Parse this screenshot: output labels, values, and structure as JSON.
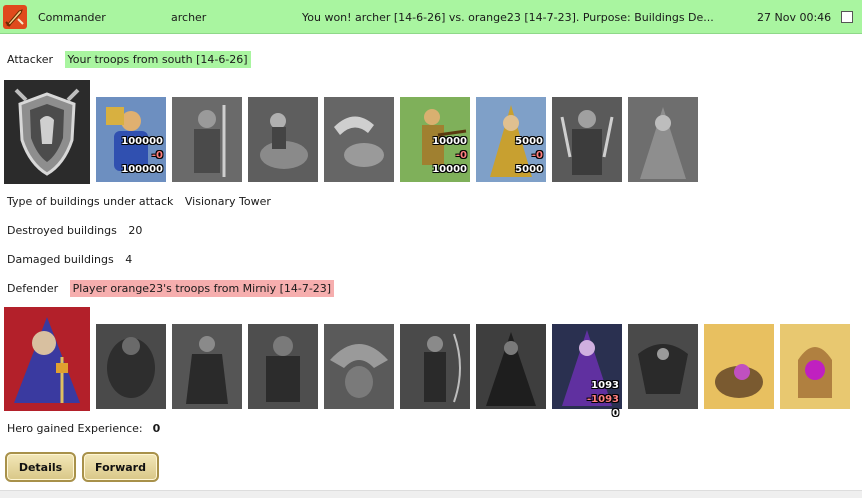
{
  "header": {
    "commander_label": "Commander",
    "name": "archer",
    "subject": "You won! archer [14-6-26] vs. orange23 [14-7-23]. Purpose: Buildings De...",
    "date": "27 Nov 00:46"
  },
  "attacker": {
    "label": "Attacker",
    "troops": "Your troops from south [14-6-26]",
    "units": [
      {
        "name": "coat-of-arms",
        "color": "gray"
      },
      {
        "name": "merchant",
        "color": "color",
        "numbers": [
          "100000",
          "-0",
          "100000"
        ]
      },
      {
        "name": "halberdier",
        "color": "gray"
      },
      {
        "name": "knight-on-horse",
        "color": "gray"
      },
      {
        "name": "pegasus",
        "color": "gray"
      },
      {
        "name": "crossbowman",
        "color": "color",
        "numbers": [
          "10000",
          "-0",
          "10000"
        ]
      },
      {
        "name": "mage",
        "color": "color",
        "numbers": [
          "5000",
          "-0",
          "5000"
        ]
      },
      {
        "name": "swordsman",
        "color": "gray"
      },
      {
        "name": "monk",
        "color": "gray"
      }
    ]
  },
  "building_type": {
    "label": "Type of buildings under attack",
    "value": "Visionary Tower"
  },
  "destroyed": {
    "label": "Destroyed buildings",
    "value": "20"
  },
  "damaged": {
    "label": "Damaged buildings",
    "value": "4"
  },
  "defender": {
    "label": "Defender",
    "troops": "Player orange23's troops from Mirniy [14-7-23]",
    "units": [
      {
        "name": "dark-hero",
        "color": "color"
      },
      {
        "name": "golem",
        "color": "gray"
      },
      {
        "name": "assassin",
        "color": "gray"
      },
      {
        "name": "dark-knight",
        "color": "gray"
      },
      {
        "name": "gargoyle",
        "color": "gray"
      },
      {
        "name": "archer-elf",
        "color": "gray"
      },
      {
        "name": "dark-priest",
        "color": "gray"
      },
      {
        "name": "necromancer",
        "color": "color",
        "numbers": [
          "1093",
          "-1093",
          "0"
        ]
      },
      {
        "name": "bone-dragon",
        "color": "gray"
      },
      {
        "name": "hatchling",
        "color": "color"
      },
      {
        "name": "egg-shrine",
        "color": "color"
      }
    ]
  },
  "experience": {
    "label": "Hero gained Experience:",
    "value": "0"
  },
  "buttons": {
    "details": "Details",
    "forward": "Forward"
  },
  "colors": {
    "header_bg": "#a9f5a0",
    "attacker_bg": "#a9f5a0",
    "defender_bg": "#f6aeae",
    "button_bg": "#e6d79d"
  }
}
